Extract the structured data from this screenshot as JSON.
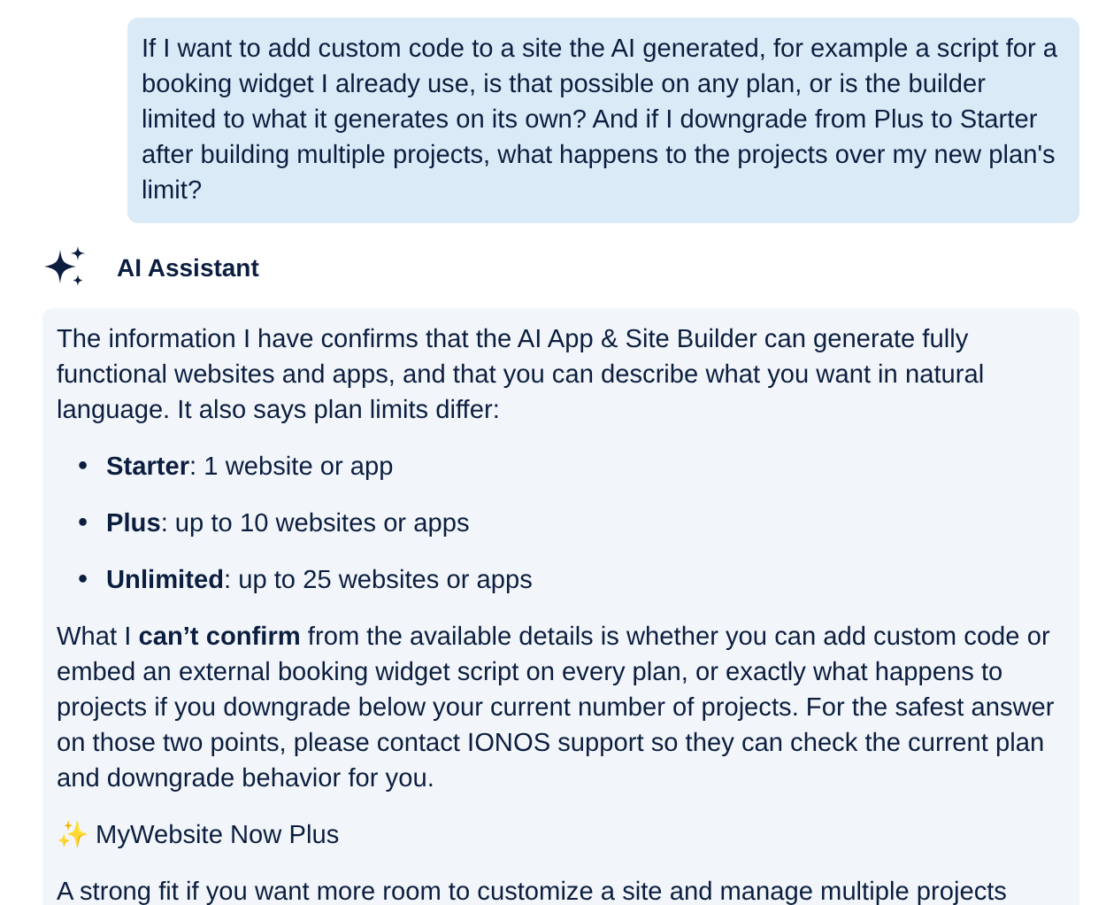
{
  "user_message": {
    "text": "If I want to add custom code to a site the AI generated, for example a script for a booking widget I already use, is that possible on any plan, or is the builder limited to what it generates on its own? And if I downgrade from Plus to Starter after building multiple projects, what happens to the projects over my new plan's limit?"
  },
  "assistant": {
    "name": "AI Assistant"
  },
  "answer": [
    {
      "kind": "paragraph",
      "text": "The information I have confirms that the AI App & Site Builder can generate fully functional websites and apps, and that you can describe what you want in natural language. It also says plan limits differ:"
    },
    {
      "kind": "list",
      "items": [
        {
          "marker": "•",
          "text": "**Starter**: 1 website or app"
        },
        {
          "marker": "•",
          "text": "**Plus**: up to 10 websites or apps"
        },
        {
          "marker": "•",
          "text": "**Unlimited**: up to 25 websites or apps"
        }
      ]
    },
    {
      "kind": "paragraph",
      "text": "What I **can’t confirm** from the available details is whether you can add custom code or embed an external booking widget script on every plan, or exactly what happens to projects if you downgrade below your current number of projects. For the safest answer on those two points, please contact IONOS support so they can check the current plan and downgrade behavior for you."
    },
    {
      "kind": "heading",
      "text": "✨ MyWebsite Now Plus"
    },
    {
      "kind": "paragraph",
      "text": "A strong fit if you want more room to customize a site and manage multiple projects"
    }
  ]
}
